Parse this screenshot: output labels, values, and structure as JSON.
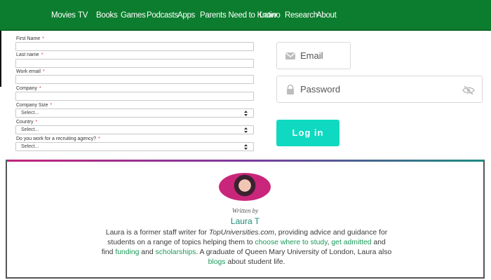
{
  "nav": {
    "items": [
      "Movies",
      "TV",
      "Books",
      "Games",
      "Podcasts",
      "Apps",
      "Parents Need to Know",
      "Latino",
      "Research",
      "About"
    ]
  },
  "form": {
    "required_mark": "*",
    "first_name_label": "First Name",
    "last_name_label": "Last name",
    "work_email_label": "Work email",
    "company_label": "Company",
    "company_size_label": "Company Size",
    "company_size_value": "Select...",
    "country_label": "Country",
    "country_value": "Select...",
    "agency_label": "Do you work for a recruiting agency?",
    "agency_value": "Select..."
  },
  "login": {
    "email_placeholder": "Email",
    "password_placeholder": "Password",
    "button_label": "Log in",
    "accent_color": "#10d9c1"
  },
  "author": {
    "written_by": "Written by",
    "name": "Laura T",
    "bio": {
      "line1_a": "Laura is a former staff writer for ",
      "line1_site": "TopUniversities.com",
      "line1_b": ", providing advice and guidance for",
      "line2_a": "students on a range of topics helping them to ",
      "line2_link1": "choose where to study",
      "line2_sep": ", ",
      "line2_link2": "get admitted",
      "line2_b": " and",
      "line3_a": "find ",
      "line3_link1": "funding",
      "line3_mid": " and ",
      "line3_link2": "scholarships",
      "line3_b": ". A graduate of Queen Mary University of London, Laura also",
      "line4_link": "blogs",
      "line4_b": " about student life."
    },
    "link_color": "#1b9a58"
  },
  "colors": {
    "nav_bg": "#0c7d2e"
  }
}
